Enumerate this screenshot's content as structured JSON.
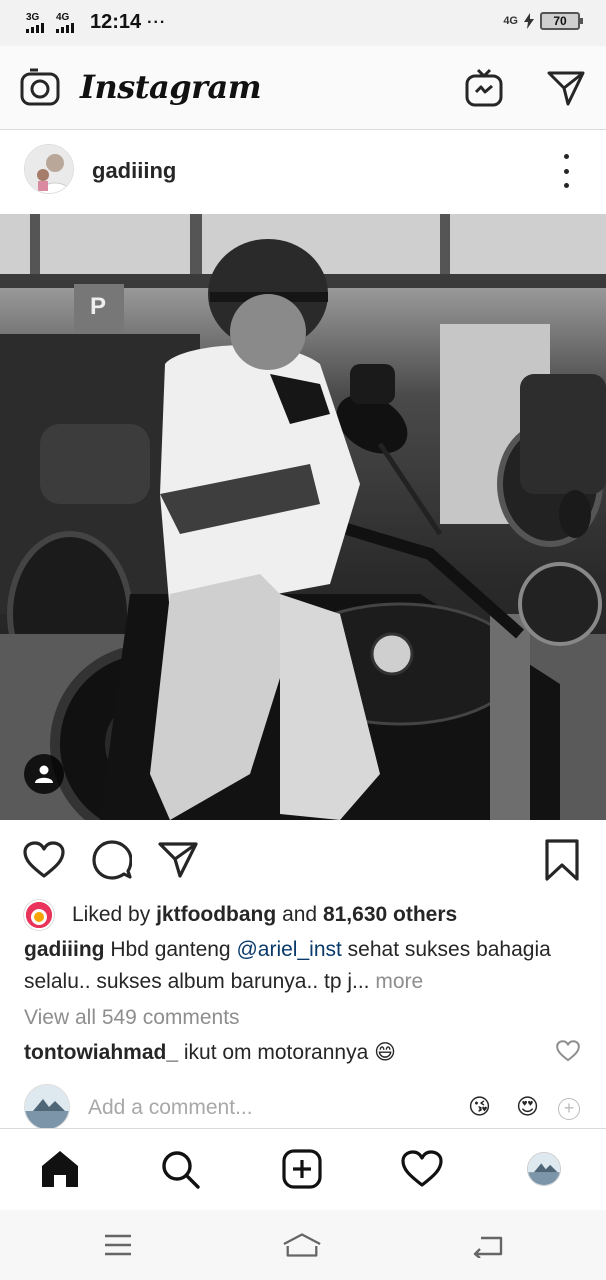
{
  "status_bar": {
    "signal1": "3G",
    "signal2": "4G",
    "time": "12:14",
    "dots": "···",
    "network": "4G",
    "battery": "70"
  },
  "header": {
    "brand": "Instagram",
    "icons": [
      "camera-icon",
      "igtv-icon",
      "direct-message-icon"
    ]
  },
  "post": {
    "username": "gadiiing",
    "likes": {
      "prefix": "Liked by",
      "liker": "jktfoodbang",
      "and": "and",
      "others": "81,630 others"
    },
    "caption": {
      "author": "gadiiing",
      "text_before": "Hbd ganteng",
      "mention": "@ariel_inst",
      "text_after": "sehat sukses bahagia selalu.. sukses album barunya.. tp j...",
      "more": "more"
    },
    "view_comments": "View all 549 comments",
    "comment": {
      "author": "tontowiahmad_",
      "text": "ikut om motorannya 😄"
    },
    "add_comment_placeholder": "Add a comment...",
    "quick_emojis": [
      "😘",
      "😍"
    ]
  },
  "bottom_nav": [
    "home-icon",
    "search-icon",
    "new-post-icon",
    "activity-icon",
    "profile-avatar"
  ],
  "colors": {
    "mention": "#0a3a6b",
    "muted": "#8e8e8e",
    "text": "#262626"
  }
}
